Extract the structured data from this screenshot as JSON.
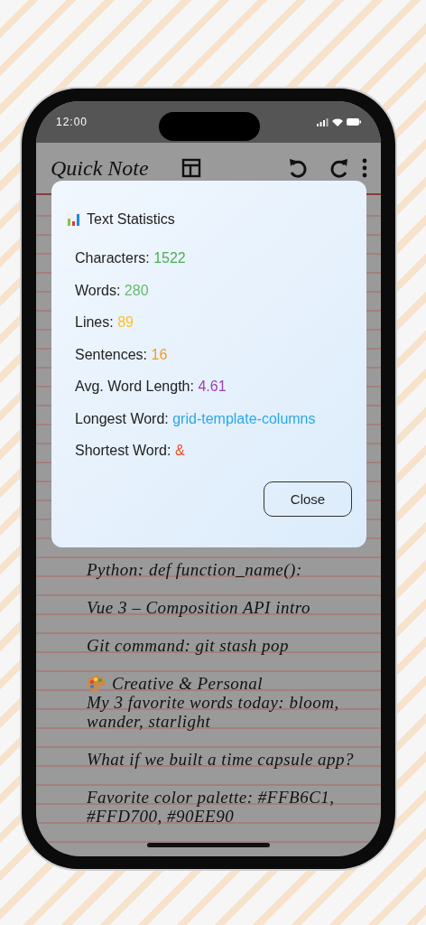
{
  "status_bar": {
    "time": "12:00"
  },
  "app_bar": {
    "title": "Quick Note"
  },
  "note": {
    "paragraphs": [
      [
        "Python: def function_name():"
      ],
      [
        "Vue 3 – Composition API intro"
      ],
      [
        "Git command: git stash pop"
      ],
      [
        "Creative & Personal",
        "My 3 favorite words today: bloom, wander, starlight"
      ],
      [
        "What if we built a time capsule app?"
      ],
      [
        "Favorite color palette: #FFB6C1, #FFD700, #90EE90"
      ]
    ]
  },
  "dialog": {
    "title": "Text Statistics",
    "stats": [
      {
        "label": "Characters:",
        "value": "1522",
        "color": "#4caf50"
      },
      {
        "label": "Words:",
        "value": "280",
        "color": "#66bb6a"
      },
      {
        "label": "Lines:",
        "value": "89",
        "color": "#fbc02d"
      },
      {
        "label": "Sentences:",
        "value": "16",
        "color": "#f39c2a"
      },
      {
        "label": "Avg. Word Length:",
        "value": "4.61",
        "color": "#9c3fb0"
      },
      {
        "label": "Longest Word:",
        "value": "grid-template-columns",
        "color": "#2aa8e8"
      },
      {
        "label": "Shortest Word:",
        "value": "&",
        "color": "#f04e23"
      }
    ],
    "buttons": [
      "Close"
    ]
  }
}
